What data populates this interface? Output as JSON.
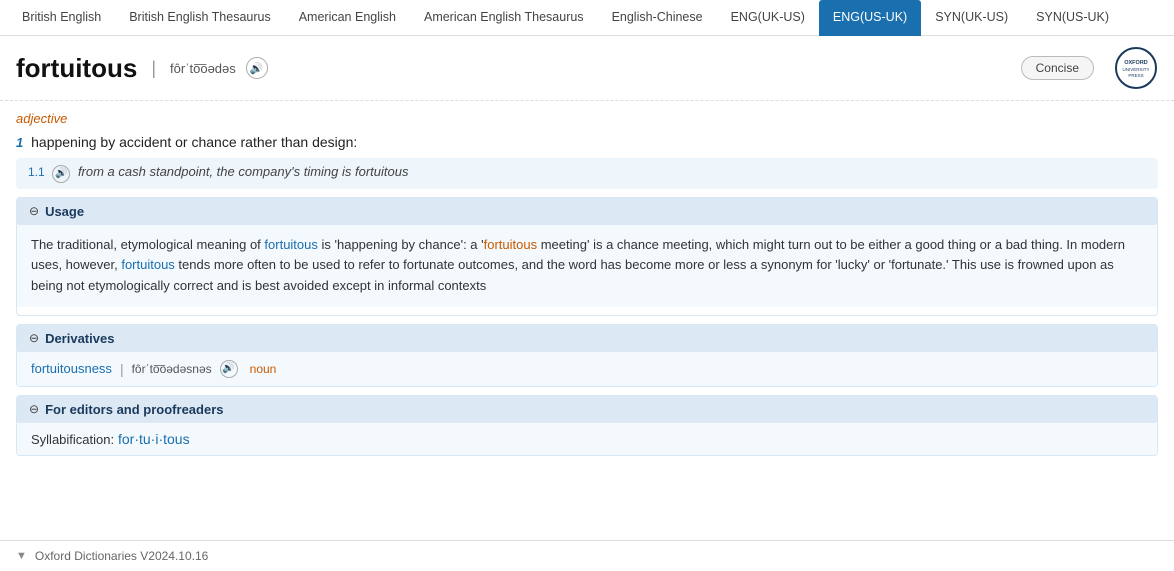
{
  "tabs": [
    {
      "id": "british-english",
      "label": "British English",
      "active": false
    },
    {
      "id": "british-english-thesaurus",
      "label": "British English Thesaurus",
      "active": false
    },
    {
      "id": "american-english",
      "label": "American English",
      "active": false
    },
    {
      "id": "american-english-thesaurus",
      "label": "American English Thesaurus",
      "active": false
    },
    {
      "id": "english-chinese",
      "label": "English-Chinese",
      "active": false
    },
    {
      "id": "eng-uk-us",
      "label": "ENG(UK-US)",
      "active": false
    },
    {
      "id": "eng-us-uk",
      "label": "ENG(US-UK)",
      "active": true
    },
    {
      "id": "syn-uk-us",
      "label": "SYN(UK-US)",
      "active": false
    },
    {
      "id": "syn-us-uk",
      "label": "SYN(US-UK)",
      "active": false
    }
  ],
  "header": {
    "word": "fortuitous",
    "separator": "|",
    "pronunciation": "fôrˈto͞oədəs",
    "sound_label": "🔊",
    "concise_button": "Concise"
  },
  "oxford": {
    "logo_text": "OXFORD\nUNIVERSITY\nPRESS"
  },
  "entry": {
    "pos": "adjective",
    "definition_number": "1",
    "definition_text": "happening by accident or chance rather than design:",
    "sub_entries": [
      {
        "number": "1.1",
        "example": "from a cash standpoint, the company's timing is fortuitous"
      }
    ],
    "usage": {
      "title": "Usage",
      "body_parts": [
        "The traditional, etymological meaning of ",
        "fortuitous",
        " is 'happening by chance': a '",
        "fortuitous",
        " meeting' is a chance meeting, which might turn out to be either a good thing or a bad thing. In modern uses, however, ",
        "fortuitous",
        " tends more often to be used to refer to fortunate outcomes, and the word has become more or less a synonym for 'lucky' or 'fortunate.' This use is frowned upon as being not etymologically correct and is best avoided except in informal contexts"
      ]
    },
    "derivatives": {
      "title": "Derivatives",
      "items": [
        {
          "word": "fortuitousness",
          "pronunciation": "fôrˈto͞oədəsnəs",
          "pos": "noun"
        }
      ]
    },
    "editors": {
      "title": "For editors and proofreaders",
      "syllabification_label": "Syllabification:",
      "syllabification": "for·tu·i·tous"
    }
  },
  "footer": {
    "version": "Oxford Dictionaries V2024.10.16"
  }
}
